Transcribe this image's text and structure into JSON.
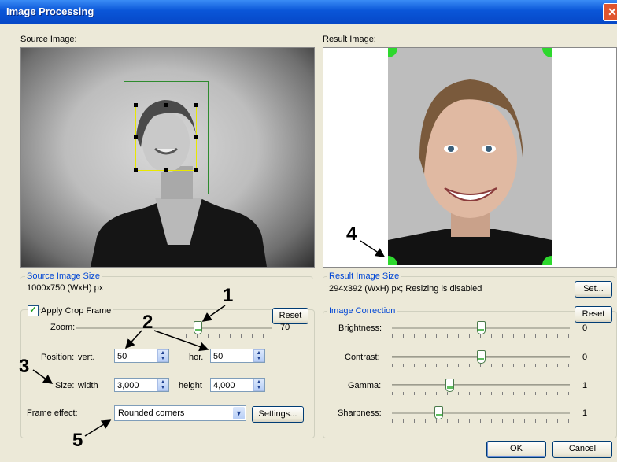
{
  "window": {
    "title": "Image Processing",
    "close_symbol": "✕"
  },
  "source": {
    "label": "Source Image:",
    "size_group_title": "Source Image Size",
    "size_value": "1000x750 (WxH) px"
  },
  "result": {
    "label": "Result Image:",
    "size_group_title": "Result Image Size",
    "size_value": "294x392 (WxH) px; Resizing is disabled",
    "set_button": "Set..."
  },
  "crop": {
    "checkbox_label": "Apply Crop Frame",
    "checked": true,
    "reset_button": "Reset",
    "zoom_label": "Zoom:",
    "zoom_value": "70",
    "position_label": "Position:",
    "vert_label": "vert.",
    "vert_value": "50",
    "hor_label": "hor.",
    "hor_value": "50",
    "size_label": "Size:",
    "width_label": "width",
    "width_value": "3,000",
    "height_label": "height",
    "height_value": "4,000",
    "frame_effect_label": "Frame effect:",
    "frame_effect_value": "Rounded corners",
    "settings_button": "Settings..."
  },
  "correction": {
    "group_title": "Image Correction",
    "reset_button": "Reset",
    "brightness_label": "Brightness:",
    "brightness_value": "0",
    "contrast_label": "Contrast:",
    "contrast_value": "0",
    "gamma_label": "Gamma:",
    "gamma_value": "1",
    "sharpness_label": "Sharpness:",
    "sharpness_value": "1"
  },
  "buttons": {
    "ok": "OK",
    "cancel": "Cancel"
  },
  "annotations": {
    "n1": "1",
    "n2": "2",
    "n3": "3",
    "n4": "4",
    "n5": "5"
  },
  "colors": {
    "title_bar": "#0a56d8",
    "group_title": "#0046d5",
    "crop_outer": "#2e8b2e",
    "crop_inner": "#e8e800",
    "corner_marks": "#2ed82e"
  }
}
